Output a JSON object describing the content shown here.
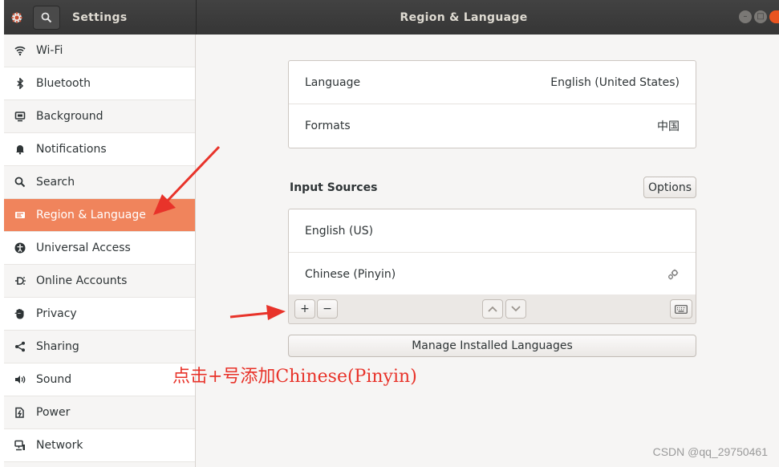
{
  "header": {
    "app_title": "Settings",
    "panel_title": "Region & Language"
  },
  "sidebar": {
    "items": [
      {
        "label": "Wi-Fi",
        "icon": "wifi-icon"
      },
      {
        "label": "Bluetooth",
        "icon": "bluetooth-icon"
      },
      {
        "label": "Background",
        "icon": "background-icon"
      },
      {
        "label": "Notifications",
        "icon": "bell-icon"
      },
      {
        "label": "Search",
        "icon": "search-icon"
      },
      {
        "label": "Region & Language",
        "icon": "flag-icon",
        "selected": true
      },
      {
        "label": "Universal Access",
        "icon": "accessibility-icon"
      },
      {
        "label": "Online Accounts",
        "icon": "online-accounts-icon"
      },
      {
        "label": "Privacy",
        "icon": "hand-icon"
      },
      {
        "label": "Sharing",
        "icon": "share-icon"
      },
      {
        "label": "Sound",
        "icon": "speaker-icon"
      },
      {
        "label": "Power",
        "icon": "power-icon"
      },
      {
        "label": "Network",
        "icon": "network-icon"
      }
    ]
  },
  "language_panel": {
    "language_label": "Language",
    "language_value": "English (United States)",
    "formats_label": "Formats",
    "formats_value": "中国"
  },
  "input_sources": {
    "title": "Input Sources",
    "options_label": "Options",
    "sources": [
      "English (US)",
      "Chinese (Pinyin)"
    ],
    "add_label": "+",
    "remove_label": "−"
  },
  "manage_label": "Manage Installed Languages",
  "annotation": "点击+号添加Chinese(Pinyin)",
  "watermark": "CSDN @qq_29750461",
  "colors": {
    "accent": "#f0845c",
    "annotation": "#e8332a",
    "headerbar": "#3c3c3c",
    "close_button": "#e95420"
  }
}
